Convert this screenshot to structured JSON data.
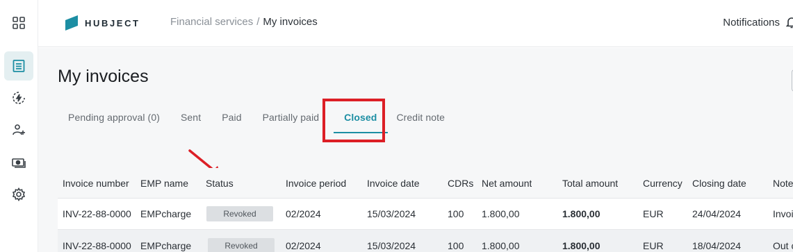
{
  "logo": {
    "text": "HUBJECT",
    "color": "#1c8ea3"
  },
  "breadcrumb": {
    "parent": "Financial services",
    "separator": "/",
    "current": "My invoices"
  },
  "header": {
    "notifications_label": "Notifications"
  },
  "page": {
    "title": "My invoices"
  },
  "tabs": [
    {
      "label": "Pending approval (0)"
    },
    {
      "label": "Sent"
    },
    {
      "label": "Paid"
    },
    {
      "label": "Partially paid"
    },
    {
      "label": "Closed",
      "active": true
    },
    {
      "label": "Credit note"
    }
  ],
  "table": {
    "columns": [
      "Invoice number",
      "EMP name",
      "Status",
      "Invoice period",
      "Invoice date",
      "CDRs",
      "Net amount",
      "Total amount",
      "Currency",
      "Closing date",
      "Note"
    ],
    "rows": [
      [
        "INV-22-88-0000",
        "EMPcharge",
        "Revoked",
        "02/2024",
        "15/03/2024",
        "100",
        "1.800,00",
        "1.800,00",
        "EUR",
        "24/04/2024",
        "Invoi"
      ],
      [
        "INV-22-88-0000",
        "EMPcharge",
        "Revoked",
        "02/2024",
        "15/03/2024",
        "100",
        "1.800,00",
        "1.800,00",
        "EUR",
        "18/04/2024",
        "Out c"
      ]
    ]
  },
  "sidebar": {
    "icons": [
      "apps-grid-icon",
      "invoice-list-icon",
      "charging-icon",
      "add-user-icon",
      "money-icon",
      "gear-icon"
    ]
  },
  "colors": {
    "accent": "#1c8ea3",
    "highlight": "#dc1f26",
    "badge_bg": "#dcdfe2"
  }
}
